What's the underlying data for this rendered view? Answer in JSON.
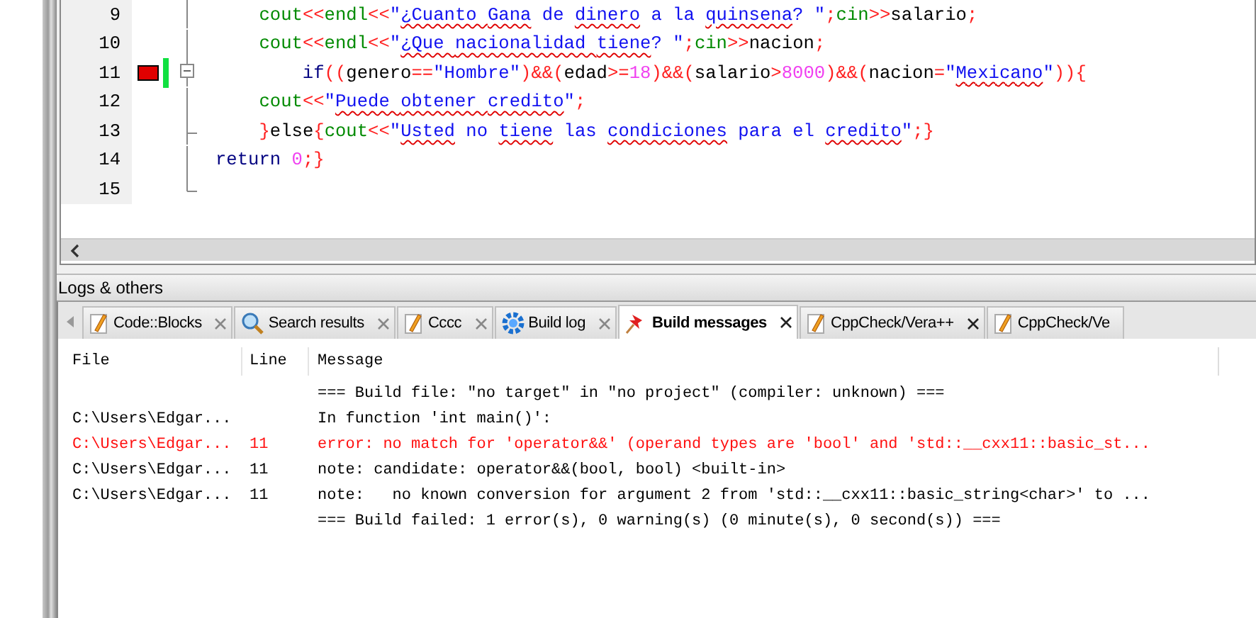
{
  "editor": {
    "lines": [
      {
        "number": "9",
        "error": false,
        "changed": false,
        "kind": "line",
        "tokens": [
          {
            "kind": "id",
            "text": "    cout"
          },
          {
            "kind": "op",
            "text": "<<"
          },
          {
            "kind": "id",
            "text": "endl"
          },
          {
            "kind": "op",
            "text": "<<"
          },
          {
            "kind": "str",
            "text": "\""
          },
          {
            "kind": "strx",
            "text": "¿Cuanto "
          },
          {
            "kind": "strx",
            "text": "Gana"
          },
          {
            "kind": "str",
            "text": " de "
          },
          {
            "kind": "strx",
            "text": "dinero"
          },
          {
            "kind": "str",
            "text": " a la "
          },
          {
            "kind": "strx",
            "text": "quinsena"
          },
          {
            "kind": "str",
            "text": "? \""
          },
          {
            "kind": "op",
            "text": ";"
          },
          {
            "kind": "id",
            "text": "cin"
          },
          {
            "kind": "op",
            "text": ">>"
          },
          {
            "kind": "plain",
            "text": "salario"
          },
          {
            "kind": "op",
            "text": ";"
          }
        ]
      },
      {
        "number": "10",
        "error": false,
        "changed": false,
        "kind": "line",
        "tokens": [
          {
            "kind": "id",
            "text": "    cout"
          },
          {
            "kind": "op",
            "text": "<<"
          },
          {
            "kind": "id",
            "text": "endl"
          },
          {
            "kind": "op",
            "text": "<<"
          },
          {
            "kind": "str",
            "text": "\""
          },
          {
            "kind": "strx",
            "text": "¿Que "
          },
          {
            "kind": "strx",
            "text": "nacionalidad "
          },
          {
            "kind": "strx",
            "text": "tiene"
          },
          {
            "kind": "str",
            "text": "? \""
          },
          {
            "kind": "op",
            "text": ";"
          },
          {
            "kind": "id",
            "text": "cin"
          },
          {
            "kind": "op",
            "text": ">>"
          },
          {
            "kind": "plain",
            "text": "nacion"
          },
          {
            "kind": "op",
            "text": ";"
          }
        ]
      },
      {
        "number": "11",
        "error": true,
        "changed": true,
        "kind": "box",
        "tokens": [
          {
            "kind": "kw",
            "text": "        if"
          },
          {
            "kind": "op",
            "text": "(("
          },
          {
            "kind": "plain",
            "text": "genero"
          },
          {
            "kind": "op",
            "text": "=="
          },
          {
            "kind": "str",
            "text": "\"Hombre\""
          },
          {
            "kind": "op",
            "text": ")&&("
          },
          {
            "kind": "plain",
            "text": "edad"
          },
          {
            "kind": "op",
            "text": ">="
          },
          {
            "kind": "num",
            "text": "18"
          },
          {
            "kind": "op",
            "text": ")&&("
          },
          {
            "kind": "plain",
            "text": "salario"
          },
          {
            "kind": "op",
            "text": ">"
          },
          {
            "kind": "num",
            "text": "8000"
          },
          {
            "kind": "op",
            "text": ")&&("
          },
          {
            "kind": "plain",
            "text": "nacion"
          },
          {
            "kind": "op",
            "text": "="
          },
          {
            "kind": "str",
            "text": "\""
          },
          {
            "kind": "strx",
            "text": "Mexicano"
          },
          {
            "kind": "str",
            "text": "\""
          },
          {
            "kind": "op",
            "text": ")){"
          }
        ]
      },
      {
        "number": "12",
        "error": false,
        "changed": false,
        "kind": "line",
        "tokens": [
          {
            "kind": "id",
            "text": "    cout"
          },
          {
            "kind": "op",
            "text": "<<"
          },
          {
            "kind": "str",
            "text": "\""
          },
          {
            "kind": "strx",
            "text": "Puede "
          },
          {
            "kind": "strx",
            "text": "obtener "
          },
          {
            "kind": "strx",
            "text": "credito"
          },
          {
            "kind": "str",
            "text": "\""
          },
          {
            "kind": "op",
            "text": ";"
          }
        ]
      },
      {
        "number": "13",
        "error": false,
        "changed": false,
        "kind": "tee",
        "tokens": [
          {
            "kind": "op",
            "text": "    }"
          },
          {
            "kind": "plain",
            "text": "else"
          },
          {
            "kind": "op",
            "text": "{"
          },
          {
            "kind": "id",
            "text": "cout"
          },
          {
            "kind": "op",
            "text": "<<"
          },
          {
            "kind": "str",
            "text": "\""
          },
          {
            "kind": "strx",
            "text": "Usted"
          },
          {
            "kind": "str",
            "text": " no "
          },
          {
            "kind": "strx",
            "text": "tiene"
          },
          {
            "kind": "str",
            "text": " las "
          },
          {
            "kind": "strx",
            "text": "condiciones"
          },
          {
            "kind": "str",
            "text": " para el "
          },
          {
            "kind": "strx",
            "text": "credito"
          },
          {
            "kind": "str",
            "text": "\""
          },
          {
            "kind": "op",
            "text": ";}"
          }
        ]
      },
      {
        "number": "14",
        "error": false,
        "changed": false,
        "kind": "line",
        "tokens": [
          {
            "kind": "kw",
            "text": "return"
          },
          {
            "kind": "num",
            "text": " 0"
          },
          {
            "kind": "op",
            "text": ";}"
          }
        ]
      },
      {
        "number": "15",
        "error": false,
        "changed": false,
        "kind": "end"
      }
    ]
  },
  "panel": {
    "title": "Logs & others",
    "tabs": [
      {
        "label": "Code::Blocks",
        "kind": "pencil",
        "selected": false
      },
      {
        "label": "Search results",
        "kind": "search",
        "selected": false
      },
      {
        "label": "Cccc",
        "kind": "pencil",
        "selected": false
      },
      {
        "label": "Build log",
        "kind": "gear",
        "selected": false
      },
      {
        "label": "Build messages",
        "kind": "pin",
        "selected": true
      },
      {
        "label": "CppCheck/Vera++",
        "kind": "pencil",
        "selected": false
      },
      {
        "label": "CppCheck/Ve",
        "kind": "pencil",
        "selected": false
      }
    ],
    "table": {
      "columns": [
        "File",
        "Line",
        "Message"
      ],
      "rows": [
        {
          "file": "",
          "line": "",
          "message": "=== Build file: \"no target\" in \"no project\" (compiler: unknown) ===",
          "error": false
        },
        {
          "file": "C:\\Users\\Edgar...",
          "line": "",
          "message": "In function 'int main()':",
          "error": false
        },
        {
          "file": "C:\\Users\\Edgar...",
          "line": "11",
          "message": "error: no match for 'operator&&' (operand types are 'bool' and 'std::__cxx11::basic_st...",
          "error": true
        },
        {
          "file": "C:\\Users\\Edgar...",
          "line": "11",
          "message": "note: candidate: operator&&(bool, bool) <built-in>",
          "error": false
        },
        {
          "file": "C:\\Users\\Edgar...",
          "line": "11",
          "message": "note:   no known conversion for argument 2 from 'std::__cxx11::basic_string<char>' to ...",
          "error": false
        },
        {
          "file": "",
          "line": "",
          "message": "=== Build failed: 1 error(s), 0 warning(s) (0 minute(s), 0 second(s)) ===",
          "error": false
        }
      ]
    }
  }
}
